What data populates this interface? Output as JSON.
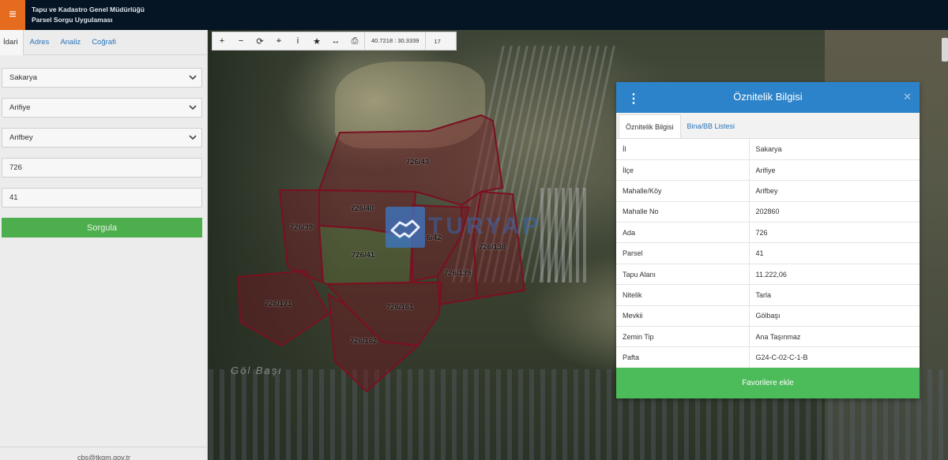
{
  "app": {
    "title_line1": "Tapu ve Kadastro Genel Müdürlüğü",
    "title_line2": "Parsel Sorgu Uygulaması"
  },
  "sidebar": {
    "tabs": [
      {
        "label": "İdari"
      },
      {
        "label": "Adres"
      },
      {
        "label": "Analiz"
      },
      {
        "label": "Coğrafi"
      }
    ],
    "province": "Sakarya",
    "district": "Arifiye",
    "neighborhood": "Arifbey",
    "block_no": "726",
    "parcel_no": "41",
    "submit_label": "Sorgula",
    "footer": "cbs@tkgm.gov.tr"
  },
  "toolbar": {
    "zoom_in_icon": "+",
    "zoom_out_icon": "−",
    "refresh_icon": "⟳",
    "locate_icon": "⌖",
    "info_icon": "i",
    "favorite_icon": "★",
    "measure_icon": "↔",
    "print_icon": "⎙",
    "coordinates": "40.7218 : 30.3339",
    "zoom_level": "17"
  },
  "map": {
    "place_label": "Göl Başı",
    "watermark_text": "TURYAP",
    "parcels": [
      {
        "label": "726/43"
      },
      {
        "label": "726/40"
      },
      {
        "label": "726/39"
      },
      {
        "label": "726/41"
      },
      {
        "label": "6/42"
      },
      {
        "label": "726/138"
      },
      {
        "label": "726/139"
      },
      {
        "label": "726/171"
      },
      {
        "label": "726/161"
      },
      {
        "label": "726/162"
      }
    ]
  },
  "panel": {
    "title": "Öznitelik Bilgisi",
    "tabs": [
      {
        "label": "Öznitelik Bilgisi"
      },
      {
        "label": "Bina/BB Listesi"
      }
    ],
    "rows": [
      {
        "key": "İl",
        "value": "Sakarya"
      },
      {
        "key": "İlçe",
        "value": "Arifiye"
      },
      {
        "key": "Mahalle/Köy",
        "value": "Arifbey"
      },
      {
        "key": "Mahalle No",
        "value": "202860"
      },
      {
        "key": "Ada",
        "value": "726"
      },
      {
        "key": "Parsel",
        "value": "41"
      },
      {
        "key": "Tapu Alanı",
        "value": "11.222,06"
      },
      {
        "key": "Nitelik",
        "value": "Tarla"
      },
      {
        "key": "Mevkii",
        "value": "Gölbaşı"
      },
      {
        "key": "Zemin Tip",
        "value": "Ana Taşınmaz"
      },
      {
        "key": "Pafta",
        "value": "G24-C-02-C-1-B"
      }
    ],
    "favorite_label": "Favorilere ekle"
  },
  "colors": {
    "accent_blue": "#2c83c9",
    "success_green": "#4cbb5a",
    "menu_orange": "#e56b1f",
    "parcel_stroke": "#7a1020",
    "topbar": "#051524"
  }
}
